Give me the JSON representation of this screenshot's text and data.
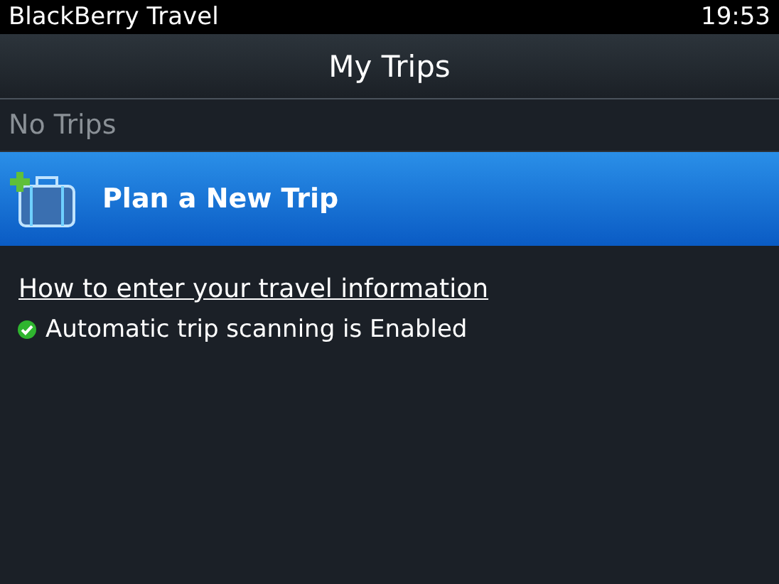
{
  "status_bar": {
    "app_name": "BlackBerry Travel",
    "time": "19:53"
  },
  "title": "My Trips",
  "empty_label": "No Trips",
  "actions": [
    {
      "label": "Plan a New Trip",
      "selected": true
    }
  ],
  "help_link": "How to enter your travel information",
  "scanning": {
    "text": "Automatic trip scanning is Enabled",
    "enabled": true
  }
}
